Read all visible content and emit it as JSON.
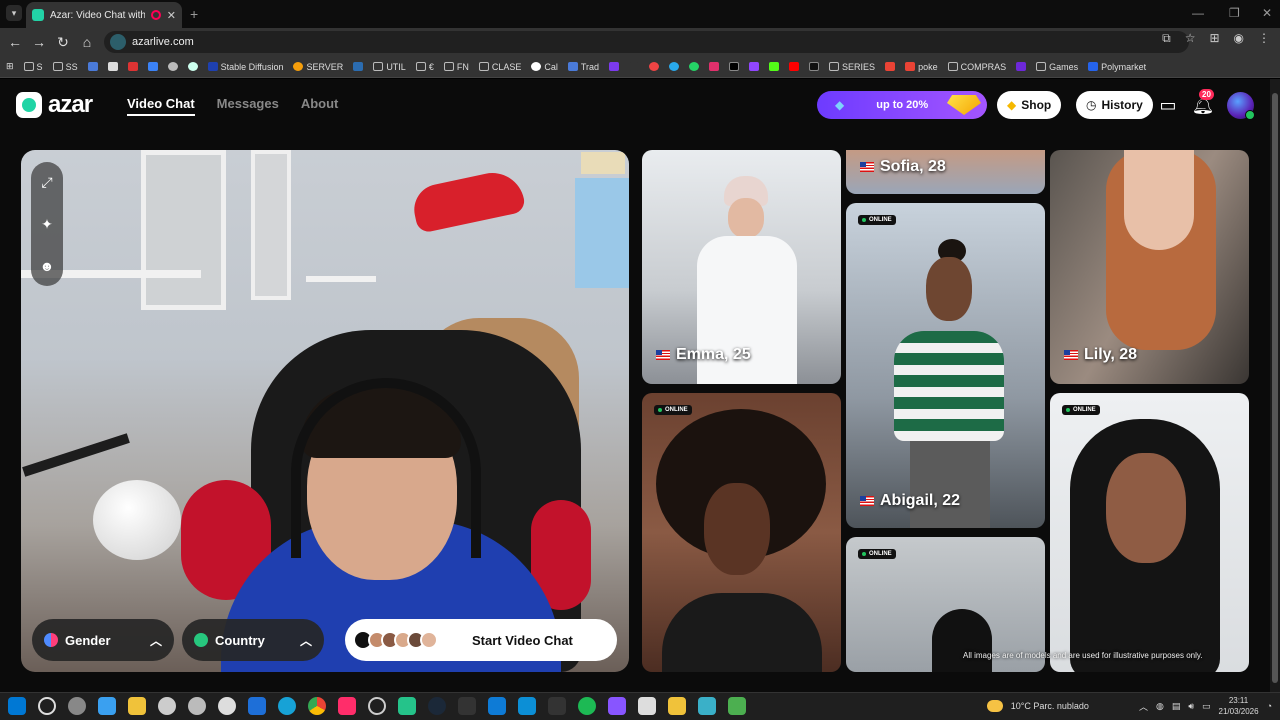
{
  "browser": {
    "tab_title": "Azar: Video Chat with New",
    "tab_close": "✕",
    "new_tab": "+",
    "url": "azarlive.com",
    "bookmarks": [
      "S",
      "SS",
      "",
      "",
      "",
      "",
      "",
      "",
      "Stable Diffusion",
      "SERVER",
      "",
      "UTIL",
      "€",
      "FN",
      "CLASE",
      "Cal",
      "Trad",
      "",
      "",
      "",
      "",
      "",
      "",
      "",
      "",
      "",
      "",
      "",
      "",
      "SERIES",
      "",
      "poke",
      "COMPRAS",
      "",
      "Games",
      "Polymarket"
    ]
  },
  "header": {
    "logo_text": "azar",
    "nav": [
      "Video Chat",
      "Messages",
      "About"
    ],
    "promo_text": "up to 20%",
    "shop_label": "Shop",
    "history_label": "History",
    "notif_count": "20"
  },
  "controls": {
    "gender_label": "Gender",
    "country_label": "Country",
    "start_label": "Start Video Chat"
  },
  "cards": {
    "online_label": "ONLINE",
    "emma": "Emma, 25",
    "sofia": "Sofia, 28",
    "abigail": "Abigail, 22",
    "lily": "Lily, 28"
  },
  "disclaimer": "All images are of models and are used for illustrative purposes only.",
  "taskbar": {
    "weather": "10°C  Parc. nublado",
    "time": "23:11",
    "date": "21/03/2026"
  },
  "colors": {
    "accent": "#1fd4a5",
    "promo": "#7c3aed",
    "online": "#22c55e"
  }
}
